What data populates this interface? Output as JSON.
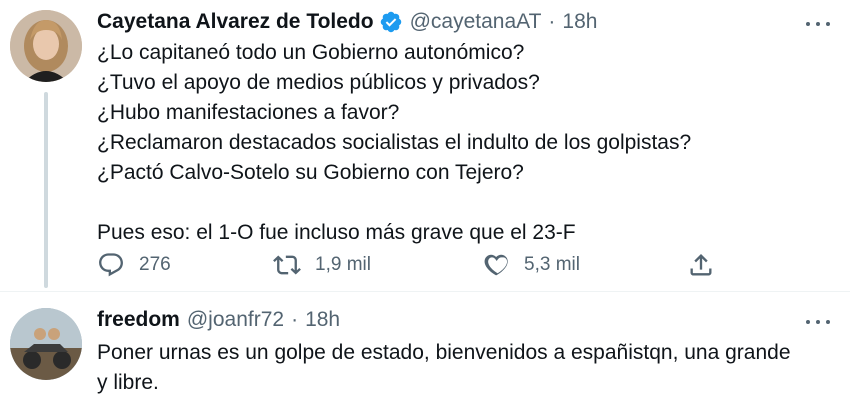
{
  "tweets": [
    {
      "name": "Cayetana Alvarez de Toledo",
      "handle": "@cayetanaAT",
      "separator": "·",
      "time": "18h",
      "verified": true,
      "avatar_icon": "profile-photo",
      "lines": [
        "¿Lo capitaneó todo un Gobierno autonómico?",
        "¿Tuvo el apoyo de medios públicos y privados?",
        "¿Hubo manifestaciones a favor?",
        "¿Reclamaron destacados socialistas el indulto de los golpistas?",
        "¿Pactó Calvo-Sotelo su Gobierno con Tejero?",
        "",
        "Pues eso: el 1-O fue incluso más grave que el 23-F"
      ],
      "actions": {
        "reply_count": "276",
        "retweet_count": "1,9 mil",
        "like_count": "5,3 mil"
      }
    },
    {
      "name": "freedom",
      "handle": "@joanfr72",
      "separator": "·",
      "time": "18h",
      "verified": false,
      "avatar_icon": "profile-photo",
      "lines": [
        "Poner urnas es un golpe de estado, bienvenidos a españistqn, una grande",
        "y libre."
      ]
    }
  ],
  "colors": {
    "text": "#0f1419",
    "secondary": "#536471",
    "verified": "#1d9bf0",
    "thread_line": "#cfd9de"
  }
}
